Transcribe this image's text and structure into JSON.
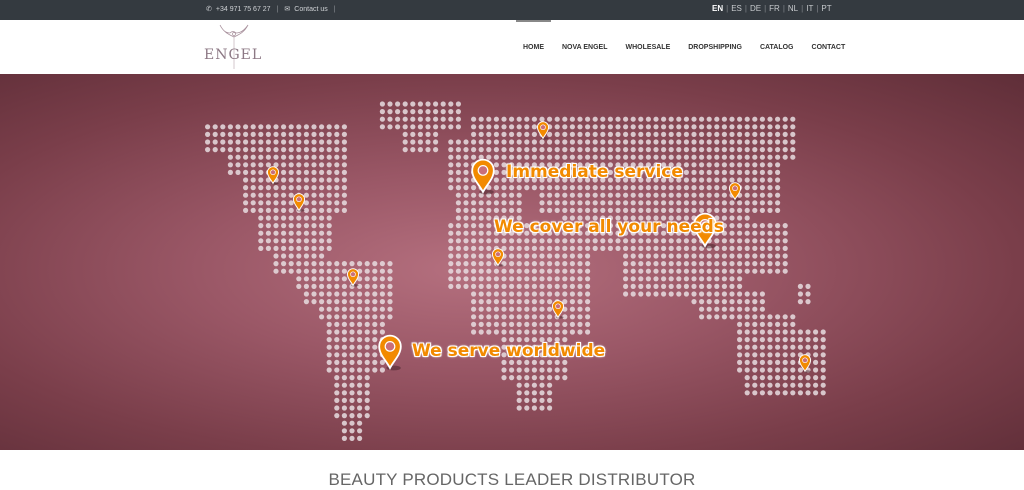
{
  "topbar": {
    "phone": "+34 971 75 67 27",
    "contact": "Contact us",
    "languages": [
      {
        "code": "EN",
        "active": true
      },
      {
        "code": "ES"
      },
      {
        "code": "DE"
      },
      {
        "code": "FR"
      },
      {
        "code": "NL"
      },
      {
        "code": "IT"
      },
      {
        "code": "PT"
      }
    ]
  },
  "header": {
    "logo_text": "ENGEL",
    "nav": [
      "HOME",
      "NOVA ENGEL",
      "WHOLESALE",
      "DROPSHIPPING",
      "CATALOG",
      "CONTACT"
    ],
    "active_nav": "HOME"
  },
  "hero": {
    "messages": [
      "Immediate service",
      "We cover all your needs",
      "We serve worldwide"
    ],
    "pin_color": "#f28a00",
    "dot_color": "#e8dde0"
  },
  "section": {
    "title": "BEAUTY PRODUCTS LEADER DISTRIBUTOR"
  }
}
